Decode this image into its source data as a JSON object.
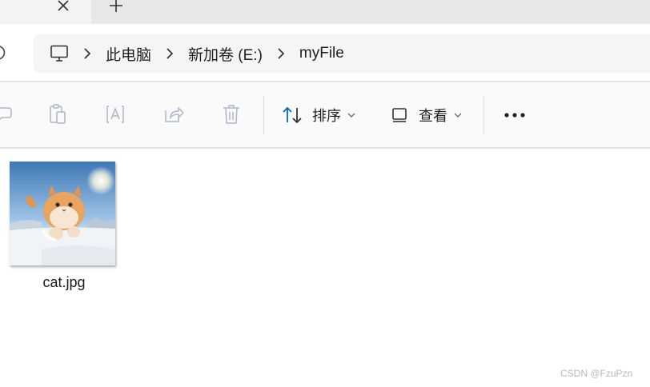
{
  "tab": {
    "close_icon": "close-icon",
    "new_tab_icon": "plus-icon"
  },
  "addressbar": {
    "crumbs": [
      {
        "label": "此电脑"
      },
      {
        "label": "新加卷 (E:)"
      },
      {
        "label": "myFile"
      }
    ],
    "root_icon": "monitor-icon",
    "separator_icon": "chevron-right-icon"
  },
  "toolbar": {
    "sort_label": "排序",
    "view_label": "查看",
    "icons": [
      "rename-icon",
      "paste-icon",
      "ai-text-icon",
      "share-icon",
      "delete-icon",
      "sort-icon",
      "view-icon",
      "more-icon"
    ]
  },
  "files": [
    {
      "name": "cat.jpg"
    }
  ],
  "watermark": "CSDN @FzuPzn",
  "colors": {
    "accent": "#0067c0",
    "tab_strip": "#f3f3f3",
    "address_bg": "#f5f5f5",
    "command_bar": "#fafafa"
  }
}
